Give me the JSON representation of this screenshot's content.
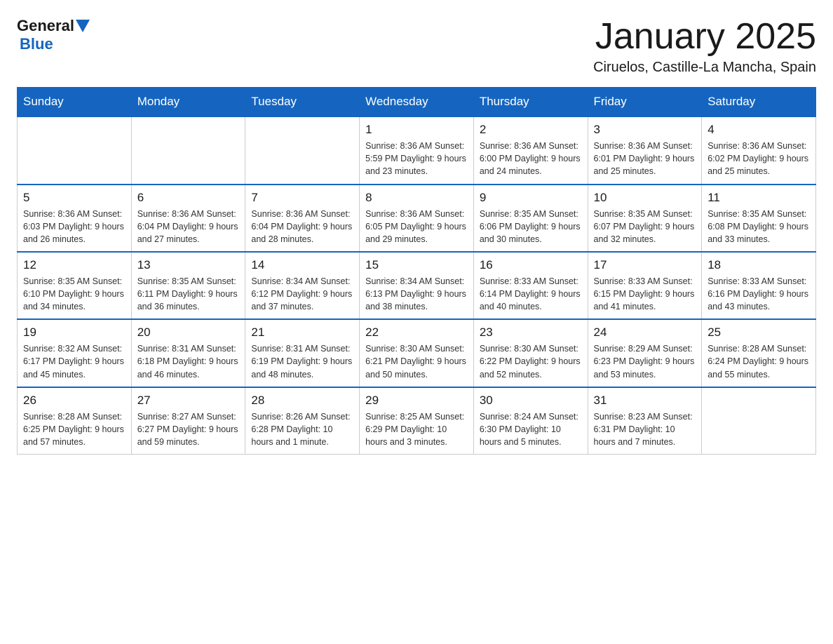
{
  "logo": {
    "general": "General",
    "blue": "Blue"
  },
  "title": "January 2025",
  "subtitle": "Ciruelos, Castille-La Mancha, Spain",
  "days_of_week": [
    "Sunday",
    "Monday",
    "Tuesday",
    "Wednesday",
    "Thursday",
    "Friday",
    "Saturday"
  ],
  "weeks": [
    [
      {
        "day": "",
        "info": ""
      },
      {
        "day": "",
        "info": ""
      },
      {
        "day": "",
        "info": ""
      },
      {
        "day": "1",
        "info": "Sunrise: 8:36 AM\nSunset: 5:59 PM\nDaylight: 9 hours and 23 minutes."
      },
      {
        "day": "2",
        "info": "Sunrise: 8:36 AM\nSunset: 6:00 PM\nDaylight: 9 hours and 24 minutes."
      },
      {
        "day": "3",
        "info": "Sunrise: 8:36 AM\nSunset: 6:01 PM\nDaylight: 9 hours and 25 minutes."
      },
      {
        "day": "4",
        "info": "Sunrise: 8:36 AM\nSunset: 6:02 PM\nDaylight: 9 hours and 25 minutes."
      }
    ],
    [
      {
        "day": "5",
        "info": "Sunrise: 8:36 AM\nSunset: 6:03 PM\nDaylight: 9 hours and 26 minutes."
      },
      {
        "day": "6",
        "info": "Sunrise: 8:36 AM\nSunset: 6:04 PM\nDaylight: 9 hours and 27 minutes."
      },
      {
        "day": "7",
        "info": "Sunrise: 8:36 AM\nSunset: 6:04 PM\nDaylight: 9 hours and 28 minutes."
      },
      {
        "day": "8",
        "info": "Sunrise: 8:36 AM\nSunset: 6:05 PM\nDaylight: 9 hours and 29 minutes."
      },
      {
        "day": "9",
        "info": "Sunrise: 8:35 AM\nSunset: 6:06 PM\nDaylight: 9 hours and 30 minutes."
      },
      {
        "day": "10",
        "info": "Sunrise: 8:35 AM\nSunset: 6:07 PM\nDaylight: 9 hours and 32 minutes."
      },
      {
        "day": "11",
        "info": "Sunrise: 8:35 AM\nSunset: 6:08 PM\nDaylight: 9 hours and 33 minutes."
      }
    ],
    [
      {
        "day": "12",
        "info": "Sunrise: 8:35 AM\nSunset: 6:10 PM\nDaylight: 9 hours and 34 minutes."
      },
      {
        "day": "13",
        "info": "Sunrise: 8:35 AM\nSunset: 6:11 PM\nDaylight: 9 hours and 36 minutes."
      },
      {
        "day": "14",
        "info": "Sunrise: 8:34 AM\nSunset: 6:12 PM\nDaylight: 9 hours and 37 minutes."
      },
      {
        "day": "15",
        "info": "Sunrise: 8:34 AM\nSunset: 6:13 PM\nDaylight: 9 hours and 38 minutes."
      },
      {
        "day": "16",
        "info": "Sunrise: 8:33 AM\nSunset: 6:14 PM\nDaylight: 9 hours and 40 minutes."
      },
      {
        "day": "17",
        "info": "Sunrise: 8:33 AM\nSunset: 6:15 PM\nDaylight: 9 hours and 41 minutes."
      },
      {
        "day": "18",
        "info": "Sunrise: 8:33 AM\nSunset: 6:16 PM\nDaylight: 9 hours and 43 minutes."
      }
    ],
    [
      {
        "day": "19",
        "info": "Sunrise: 8:32 AM\nSunset: 6:17 PM\nDaylight: 9 hours and 45 minutes."
      },
      {
        "day": "20",
        "info": "Sunrise: 8:31 AM\nSunset: 6:18 PM\nDaylight: 9 hours and 46 minutes."
      },
      {
        "day": "21",
        "info": "Sunrise: 8:31 AM\nSunset: 6:19 PM\nDaylight: 9 hours and 48 minutes."
      },
      {
        "day": "22",
        "info": "Sunrise: 8:30 AM\nSunset: 6:21 PM\nDaylight: 9 hours and 50 minutes."
      },
      {
        "day": "23",
        "info": "Sunrise: 8:30 AM\nSunset: 6:22 PM\nDaylight: 9 hours and 52 minutes."
      },
      {
        "day": "24",
        "info": "Sunrise: 8:29 AM\nSunset: 6:23 PM\nDaylight: 9 hours and 53 minutes."
      },
      {
        "day": "25",
        "info": "Sunrise: 8:28 AM\nSunset: 6:24 PM\nDaylight: 9 hours and 55 minutes."
      }
    ],
    [
      {
        "day": "26",
        "info": "Sunrise: 8:28 AM\nSunset: 6:25 PM\nDaylight: 9 hours and 57 minutes."
      },
      {
        "day": "27",
        "info": "Sunrise: 8:27 AM\nSunset: 6:27 PM\nDaylight: 9 hours and 59 minutes."
      },
      {
        "day": "28",
        "info": "Sunrise: 8:26 AM\nSunset: 6:28 PM\nDaylight: 10 hours and 1 minute."
      },
      {
        "day": "29",
        "info": "Sunrise: 8:25 AM\nSunset: 6:29 PM\nDaylight: 10 hours and 3 minutes."
      },
      {
        "day": "30",
        "info": "Sunrise: 8:24 AM\nSunset: 6:30 PM\nDaylight: 10 hours and 5 minutes."
      },
      {
        "day": "31",
        "info": "Sunrise: 8:23 AM\nSunset: 6:31 PM\nDaylight: 10 hours and 7 minutes."
      },
      {
        "day": "",
        "info": ""
      }
    ]
  ]
}
